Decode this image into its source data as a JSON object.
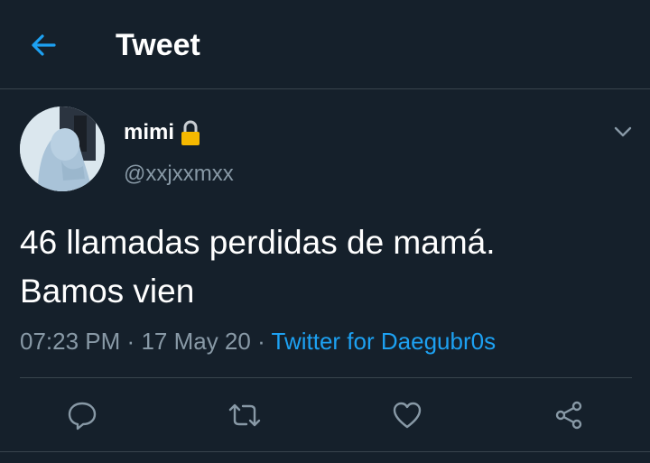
{
  "header": {
    "title": "Tweet",
    "back_icon": "arrow-left-icon"
  },
  "colors": {
    "background": "#15202b",
    "accent": "#1da1f2",
    "secondary_text": "#8899a6",
    "divider": "#38444d",
    "lock": "#f5b800"
  },
  "tweet": {
    "author_name": "mimi",
    "author_badge_icon": "lock-icon",
    "author_handle": "@xxjxxmxx",
    "text_line1": "46 llamadas perdidas de mamá.",
    "text_line2": "Bamos vien",
    "time": "07:23 PM",
    "date": "17 May 20",
    "source": "Twitter for Daegubr0s",
    "separator": "·"
  },
  "actions": [
    "reply-icon",
    "retweet-icon",
    "like-icon",
    "share-icon"
  ]
}
